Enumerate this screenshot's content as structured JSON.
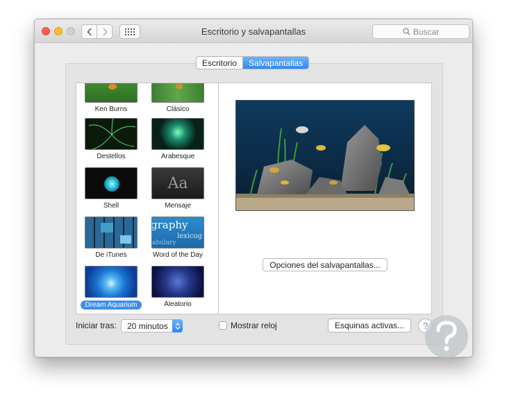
{
  "window": {
    "title": "Escritorio y salvapantallas"
  },
  "search": {
    "placeholder": "Buscar",
    "icon": "search-icon"
  },
  "tabs": [
    {
      "label": "Escritorio",
      "active": false
    },
    {
      "label": "Salvapantallas",
      "active": true
    }
  ],
  "screensavers": [
    {
      "label": "Ken Burns",
      "selected": false
    },
    {
      "label": "Clásico",
      "selected": false
    },
    {
      "label": "Destellos",
      "selected": false
    },
    {
      "label": "Arabesque",
      "selected": false
    },
    {
      "label": "Shell",
      "selected": false
    },
    {
      "label": "Mensaje",
      "selected": false
    },
    {
      "label": "De iTunes",
      "selected": false
    },
    {
      "label": "Word of the Day",
      "selected": false
    },
    {
      "label": "Dream Aquarium",
      "selected": true
    },
    {
      "label": "Aleatorio",
      "selected": false
    }
  ],
  "thumb_text": {
    "mensaje": "Aa",
    "word_of_day_main": "graphy",
    "word_of_day_sub": "lexicog",
    "word_of_day_tiny": "abulary"
  },
  "options_button": "Opciones del salvapantallas...",
  "start_after": {
    "label": "Iniciar tras:",
    "value": "20 minutos"
  },
  "show_clock": {
    "label": "Mostrar reloj",
    "checked": false
  },
  "hot_corners_button": "Esquinas activas...",
  "help_button": "?",
  "colors": {
    "accent": "#3d8ee8",
    "close": "#fc5e57",
    "minimize": "#fdbc2e"
  }
}
